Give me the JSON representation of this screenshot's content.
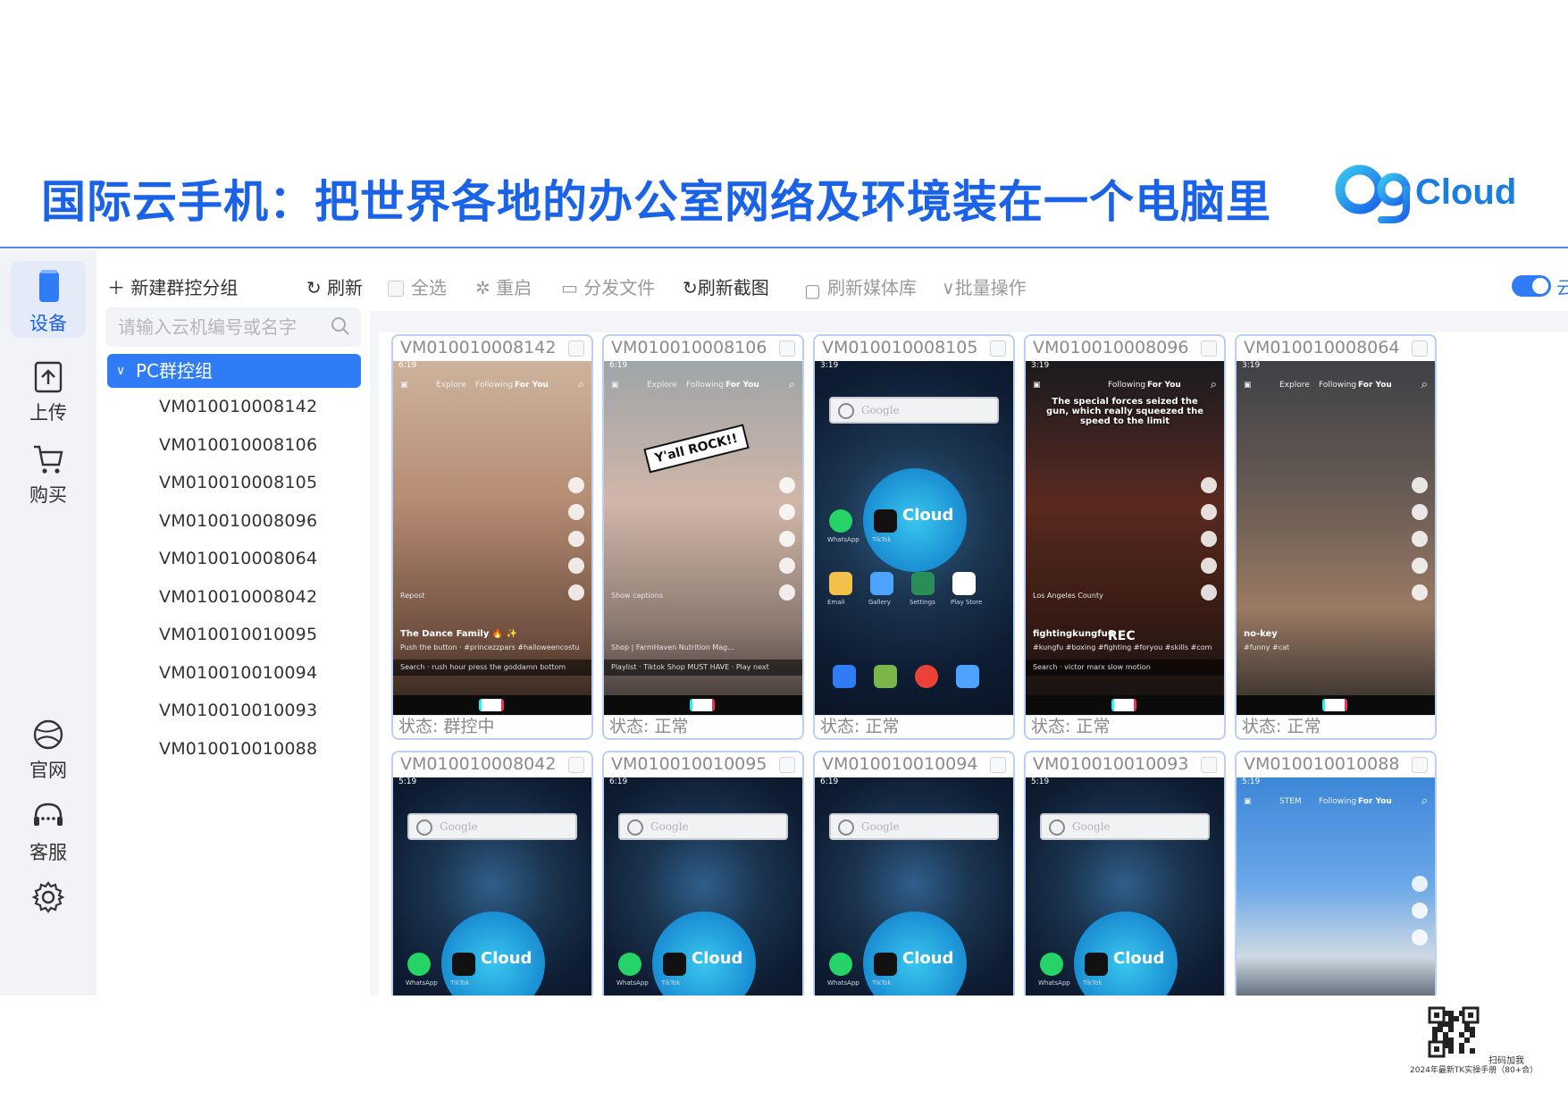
{
  "slide": {
    "title": "国际云手机：把世界各地的办公室网络及环境装在一个电脑里",
    "brand": "OgCloud",
    "qr_caption": "扫码加我",
    "footer_note": "2024年最新TK实操手册（80+合）"
  },
  "leftnav": [
    {
      "label": "设备",
      "icon": "phone-device-icon",
      "active": true
    },
    {
      "label": "上传",
      "icon": "upload-icon",
      "active": false
    },
    {
      "label": "购买",
      "icon": "cart-icon",
      "active": false
    },
    {
      "label": "官网",
      "icon": "globe-icon",
      "active": false
    },
    {
      "label": "客服",
      "icon": "headset-icon",
      "active": false
    },
    {
      "label": "",
      "icon": "gear-icon",
      "active": false
    }
  ],
  "groups": {
    "new_group_label": "新建群控分组",
    "refresh_label": "刷新",
    "search_placeholder": "请输入云机编号或名字",
    "group_name": "PC群控组",
    "devices": [
      "VM010010008142",
      "VM010010008106",
      "VM010010008105",
      "VM010010008096",
      "VM010010008064",
      "VM010010008042",
      "VM010010010095",
      "VM010010010094",
      "VM010010010093",
      "VM010010010088"
    ]
  },
  "toolbar": {
    "select_all": "全选",
    "restart": "重启",
    "distribute_file": "分发文件",
    "refresh_screenshot": "刷新截图",
    "refresh_media": "刷新媒体库",
    "batch_ops": "批量操作",
    "toggle_label": "云"
  },
  "phones": [
    {
      "id": "VM010010008142",
      "status": "状态: 群控中",
      "screen": "feed",
      "time": "6:19",
      "tabs": [
        "Explore",
        "Following",
        "For You"
      ],
      "caption": "The Dance Family 🔥 ✨",
      "sub": "Push the button · #princezzpars #halloweencostume #ru... See more",
      "search": "Search · rush hour press the goddamn bottom",
      "tag": "Repost"
    },
    {
      "id": "VM010010008106",
      "status": "状态: 正常",
      "screen": "feed",
      "time": "6:19",
      "tabs": [
        "Explore",
        "Following",
        "For You"
      ],
      "caption": "Y'all ROCK!!",
      "sub": "Shop | FarmHaven Nutrition Mag...",
      "search": "Playlist · Tiktok Shop MUST HAVE · Play next",
      "tag": "Show captions"
    },
    {
      "id": "VM010010008105",
      "status": "状态: 正常",
      "screen": "home",
      "time": "3:19",
      "google": "Google",
      "apps": [
        "WhatsApp",
        "TikTok",
        "Email",
        "Gallery",
        "Settings",
        "Play Store"
      ],
      "cloud": "Cloud"
    },
    {
      "id": "VM010010008096",
      "status": "状态: 正常",
      "screen": "feed",
      "time": "3:19",
      "tabs": [
        "Following",
        "For You"
      ],
      "caption": "fightingkungfu6",
      "sub": "#kungfu #boxing #fighting #foryou #skills #combat #fyp #tiktok",
      "search": "Search · victor marx slow motion",
      "tag": "Los Angeles County",
      "overlay": "The special forces seized the gun, which really squeezed the speed to the limit",
      "rec": "REC"
    },
    {
      "id": "VM010010008064",
      "status": "状态: 正常",
      "screen": "feed",
      "time": "3:19",
      "tabs": [
        "Explore",
        "Following",
        "For You"
      ],
      "caption": "no-key",
      "sub": "#funny #cat",
      "search": "",
      "tag": ""
    },
    {
      "id": "VM010010008042",
      "status": "",
      "screen": "home",
      "time": "5:19",
      "google": "Google",
      "apps": [
        "WhatsApp",
        "TikTok"
      ],
      "cloud": "Cloud"
    },
    {
      "id": "VM010010010095",
      "status": "",
      "screen": "home",
      "time": "6:19",
      "google": "Google",
      "apps": [
        "WhatsApp",
        "TikTok"
      ],
      "cloud": "Cloud"
    },
    {
      "id": "VM010010010094",
      "status": "",
      "screen": "home",
      "time": "6:19",
      "google": "Google",
      "apps": [
        "WhatsApp",
        "TikTok"
      ],
      "cloud": "Cloud"
    },
    {
      "id": "VM010010010093",
      "status": "",
      "screen": "home",
      "time": "5:19",
      "google": "Google",
      "apps": [
        "WhatsApp",
        "TikTok"
      ],
      "cloud": "Cloud"
    },
    {
      "id": "VM010010010088",
      "status": "",
      "screen": "feed",
      "time": "5:19",
      "tabs": [
        "STEM",
        "Following",
        "For You"
      ],
      "caption": "",
      "sub": "",
      "search": "",
      "tag": ""
    }
  ],
  "colors": {
    "accent": "#1a63e8",
    "selected": "#2f7cf6",
    "card_border": "#b9d0f2"
  }
}
